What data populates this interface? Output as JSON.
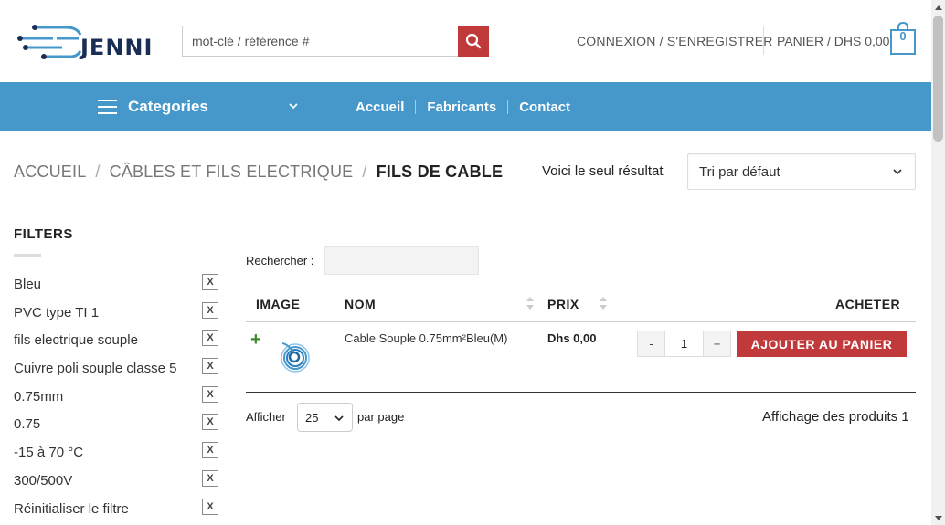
{
  "header": {
    "logo_text": "JENNI",
    "search_placeholder": "mot-clé / référence #",
    "login_label": "CONNEXION / S'ENREGISTRER",
    "cart_label": "PANIER / DHS 0,00",
    "cart_count": "0"
  },
  "nav": {
    "categories_label": "Categories",
    "links": [
      "Accueil",
      "Fabricants",
      "Contact"
    ]
  },
  "breadcrumb": {
    "items": [
      "ACCUEIL",
      "CÂBLES ET FILS ELECTRIQUE"
    ],
    "current": "FILS DE CABLE",
    "separator": "/"
  },
  "results": {
    "count_text": "Voici le seul résultat",
    "sort_selected": "Tri par défaut"
  },
  "sidebar": {
    "title": "FILTERS",
    "remove_symbol": "X",
    "filters": [
      "Bleu",
      "PVC type TI 1",
      "fils electrique souple",
      "Cuivre poli souple classe 5",
      "0.75mm",
      "0.75",
      "-15 à 70 °C",
      "300/500V",
      "Réinitialiser le filtre"
    ]
  },
  "table": {
    "search_label": "Rechercher :",
    "columns": [
      "IMAGE",
      "NOM",
      "PRIX",
      "ACHETER"
    ],
    "rows": [
      {
        "toggle": "+",
        "name": "Cable Souple 0.75mm²Bleu(M)",
        "price": "Dhs 0,00",
        "qty_minus": "-",
        "qty": "1",
        "qty_plus": "+",
        "add_label": "AJOUTER AU PANIER"
      }
    ],
    "show_label": "Afficher",
    "per_page_value": "25",
    "per_page_label": "par page",
    "pagination_info": "Affichage des produits 1"
  },
  "colors": {
    "nav_blue": "#4698cb",
    "accent_red": "#c0393b",
    "toggle_green": "#3c8a2e",
    "logo_navy": "#1a2e55"
  }
}
